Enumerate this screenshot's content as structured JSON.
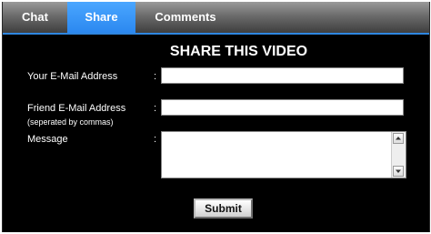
{
  "tabs": [
    {
      "label": "Chat"
    },
    {
      "label": "Share",
      "active": true
    },
    {
      "label": "Comments"
    }
  ],
  "heading": "SHARE THIS VIDEO",
  "form": {
    "your_email_label": "Your E-Mail Address",
    "friend_email_label": "Friend E-Mail Address",
    "friend_email_hint": "(seperated by commas)",
    "message_label": "Message",
    "separator": ":",
    "your_email_value": "",
    "friend_email_value": "",
    "message_value": "",
    "submit_label": "Submit"
  },
  "colors": {
    "background": "#000000",
    "active_tab": "#2b88f0",
    "tab_bar": "#6b6b6b",
    "accent_line": "#2f86e0"
  },
  "icons": {
    "scroll_up": "scroll-up-arrow-icon",
    "scroll_down": "scroll-down-arrow-icon"
  }
}
